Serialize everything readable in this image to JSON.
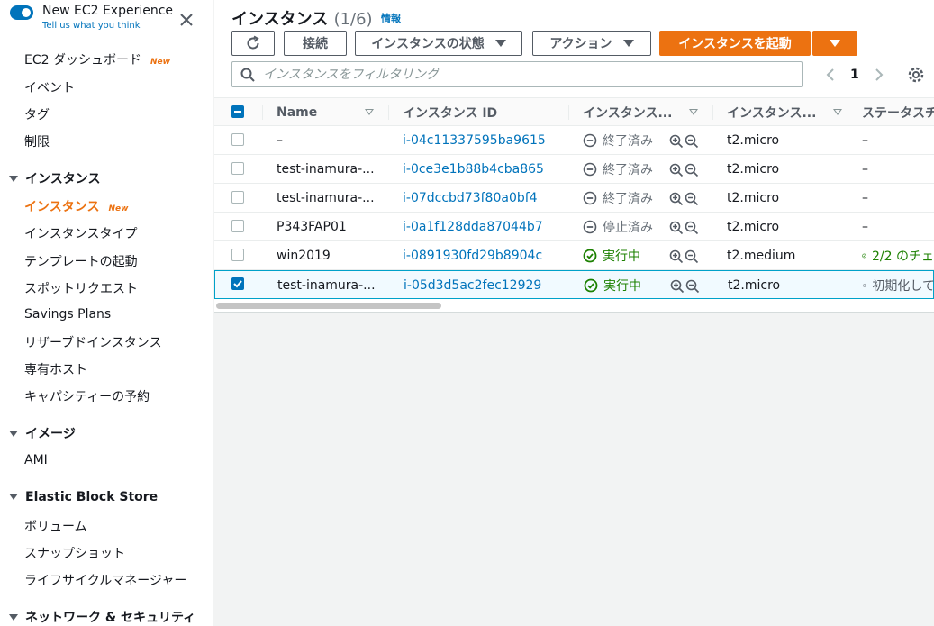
{
  "new_experience": {
    "title": "New EC2 Experience",
    "feedback_link": "Tell us what you think"
  },
  "sidebar": {
    "items_top": [
      {
        "label": "EC2 ダッシュボード",
        "badge": "New"
      },
      {
        "label": "イベント"
      },
      {
        "label": "タグ"
      },
      {
        "label": "制限"
      }
    ],
    "sections": [
      {
        "header": "インスタンス",
        "items": [
          {
            "label": "インスタンス",
            "badge": "New",
            "active": true
          },
          {
            "label": "インスタンスタイプ"
          },
          {
            "label": "テンプレートの起動"
          },
          {
            "label": "スポットリクエスト"
          },
          {
            "label": "Savings Plans"
          },
          {
            "label": "リザーブドインスタンス"
          },
          {
            "label": "専有ホスト"
          },
          {
            "label": "キャパシティーの予約"
          }
        ]
      },
      {
        "header": "イメージ",
        "items": [
          {
            "label": "AMI"
          }
        ]
      },
      {
        "header": "Elastic Block Store",
        "items": [
          {
            "label": "ボリューム"
          },
          {
            "label": "スナップショット"
          },
          {
            "label": "ライフサイクルマネージャー"
          }
        ]
      },
      {
        "header": "ネットワーク & セキュリティ",
        "items": []
      }
    ]
  },
  "header": {
    "title": "インスタンス",
    "count": "(1/6)",
    "info_link": "情報"
  },
  "toolbar": {
    "refresh_icon": "refresh-icon",
    "connect_label": "接続",
    "instance_state_label": "インスタンスの状態",
    "actions_label": "アクション",
    "launch_label": "インスタンスを起動"
  },
  "search": {
    "placeholder": "インスタンスをフィルタリング"
  },
  "pagination": {
    "current_page": "1"
  },
  "table": {
    "columns": [
      "Name",
      "インスタンス ID",
      "インスタンス...",
      "インスタンス...",
      "ステータスチ"
    ],
    "rows": [
      {
        "name": "–",
        "id": "i-04c11337595ba9615",
        "state": "終了済み",
        "state_kind": "terminated",
        "type": "t2.micro",
        "status": "–",
        "status_kind": "none",
        "selected": false
      },
      {
        "name": "test-inamura-...",
        "id": "i-0ce3e1b88b4cba865",
        "state": "終了済み",
        "state_kind": "terminated",
        "type": "t2.micro",
        "status": "–",
        "status_kind": "none",
        "selected": false
      },
      {
        "name": "test-inamura-...",
        "id": "i-07dccbd73f80a0bf4",
        "state": "終了済み",
        "state_kind": "terminated",
        "type": "t2.micro",
        "status": "–",
        "status_kind": "none",
        "selected": false
      },
      {
        "name": "P343FAP01",
        "id": "i-0a1f128dda87044b7",
        "state": "停止済み",
        "state_kind": "stopped",
        "type": "t2.micro",
        "status": "–",
        "status_kind": "none",
        "selected": false
      },
      {
        "name": "win2019",
        "id": "i-0891930fd29b8904c",
        "state": "実行中",
        "state_kind": "running",
        "type": "t2.medium",
        "status": "2/2 のチェ",
        "status_kind": "ok",
        "selected": false
      },
      {
        "name": "test-inamura-...",
        "id": "i-05d3d5ac2fec12929",
        "state": "実行中",
        "state_kind": "running",
        "type": "t2.micro",
        "status": "初期化して",
        "status_kind": "pending",
        "selected": true
      }
    ]
  },
  "colors": {
    "accent": "#ec7211",
    "link": "#0073bb",
    "running": "#1d8102",
    "muted": "#687078"
  }
}
